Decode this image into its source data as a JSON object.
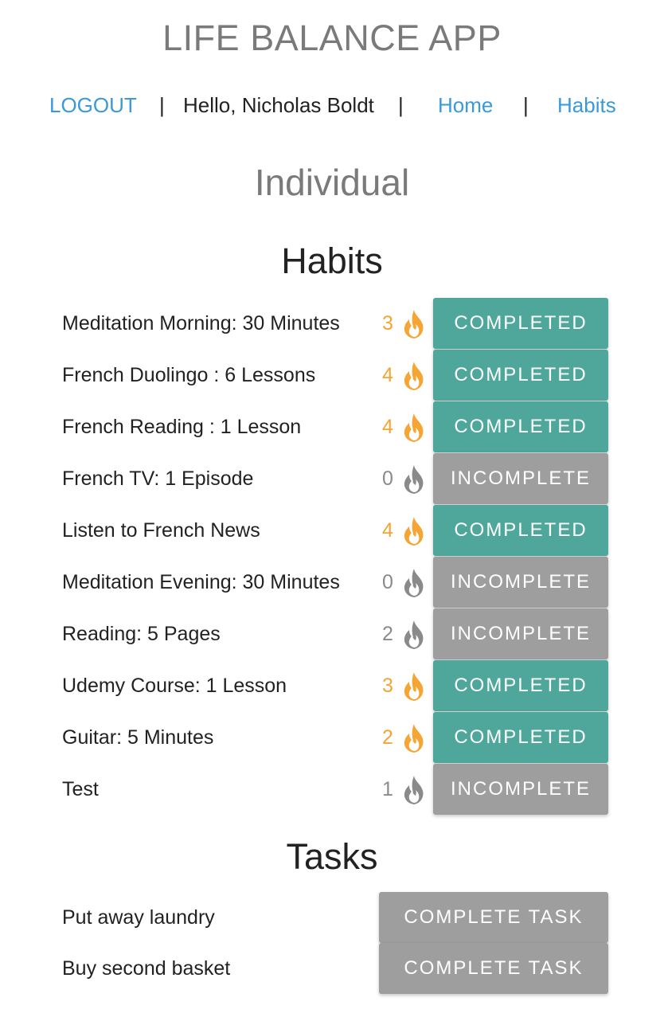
{
  "app": {
    "title": "LIFE BALANCE APP"
  },
  "nav": {
    "logout_label": "LOGOUT",
    "separator": "|",
    "greeting": "Hello, Nicholas Boldt",
    "home_label": "Home",
    "habits_label": "Habits"
  },
  "main": {
    "section_title": "Individual",
    "habits_title": "Habits",
    "tasks_title": "Tasks"
  },
  "colors": {
    "completed": "#4fa69a",
    "incomplete": "#9e9e9e",
    "flame_active": "#f4a533",
    "flame_inactive": "#8a8a8a",
    "link": "#3a9ad9"
  },
  "habits": [
    {
      "name": "Meditation Morning:  30 Minutes",
      "streak": "3",
      "flame": "flame-icon",
      "active": true,
      "status": "COMPLETED"
    },
    {
      "name": "French Duolingo :  6 Lessons",
      "streak": "4",
      "flame": "flame-icon",
      "active": true,
      "status": "COMPLETED"
    },
    {
      "name": "French Reading :  1 Lesson",
      "streak": "4",
      "flame": "flame-icon",
      "active": true,
      "status": "COMPLETED"
    },
    {
      "name": "French TV:  1 Episode",
      "streak": "0",
      "flame": "flame-icon",
      "active": false,
      "status": "INCOMPLETE"
    },
    {
      "name": "Listen to French News",
      "streak": "4",
      "flame": "flame-icon",
      "active": true,
      "status": "COMPLETED"
    },
    {
      "name": "Meditation Evening:  30 Minutes",
      "streak": "0",
      "flame": "flame-icon",
      "active": false,
      "status": "INCOMPLETE"
    },
    {
      "name": "Reading:  5 Pages",
      "streak": "2",
      "flame": "flame-icon",
      "active": false,
      "status": "INCOMPLETE"
    },
    {
      "name": "Udemy Course:  1 Lesson",
      "streak": "3",
      "flame": "flame-icon",
      "active": true,
      "status": "COMPLETED"
    },
    {
      "name": "Guitar:  5 Minutes",
      "streak": "2",
      "flame": "flame-icon",
      "active": true,
      "status": "COMPLETED"
    },
    {
      "name": "Test",
      "streak": "1",
      "flame": "flame-icon",
      "active": false,
      "status": "INCOMPLETE"
    }
  ],
  "tasks": [
    {
      "name": "Put away laundry",
      "button_label": "COMPLETE TASK"
    },
    {
      "name": "Buy second basket",
      "button_label": "COMPLETE TASK"
    }
  ]
}
